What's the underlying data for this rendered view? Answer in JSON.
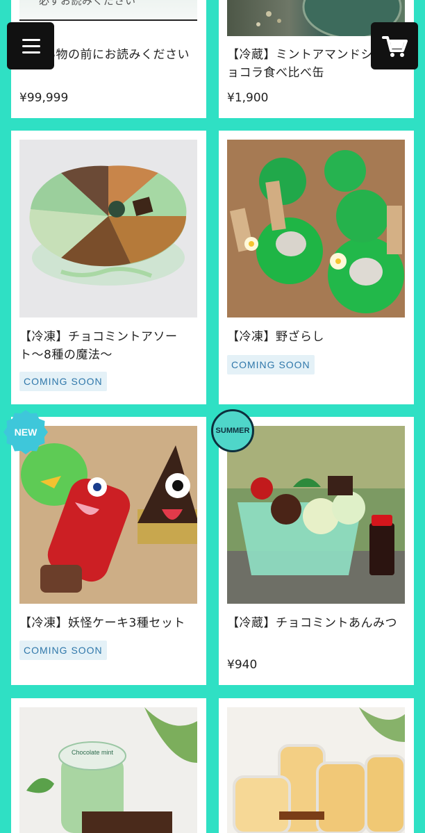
{
  "header": {
    "menu_icon": "hamburger-menu-icon",
    "cart_icon": "shopping-cart-icon"
  },
  "products": [
    {
      "title": "必ずお読みください",
      "title_full": "お買い物の前にお読みください",
      "price": "¥99,999"
    },
    {
      "title": "【冷蔵】ミントアマンドショコラ食べ比べ缶",
      "price": "¥1,900"
    },
    {
      "title": "【冷凍】チョコミントアソート〜8種の魔法〜",
      "status": "COMING SOON"
    },
    {
      "title": "【冷凍】野ざらし",
      "status": "COMING SOON"
    },
    {
      "title": "【冷凍】妖怪ケーキ3種セット",
      "status": "COMING SOON",
      "badge": "NEW"
    },
    {
      "title": "【冷蔵】チョコミントあんみつ",
      "price": "¥940",
      "badge": "SUMMER"
    },
    {
      "title": "",
      "label_text": "Chocolate mint"
    },
    {
      "title": ""
    }
  ],
  "colors": {
    "background": "#2fe0c4",
    "card": "#ffffff",
    "status_text": "#2f77aa",
    "status_bg": "#e4f1f7"
  }
}
